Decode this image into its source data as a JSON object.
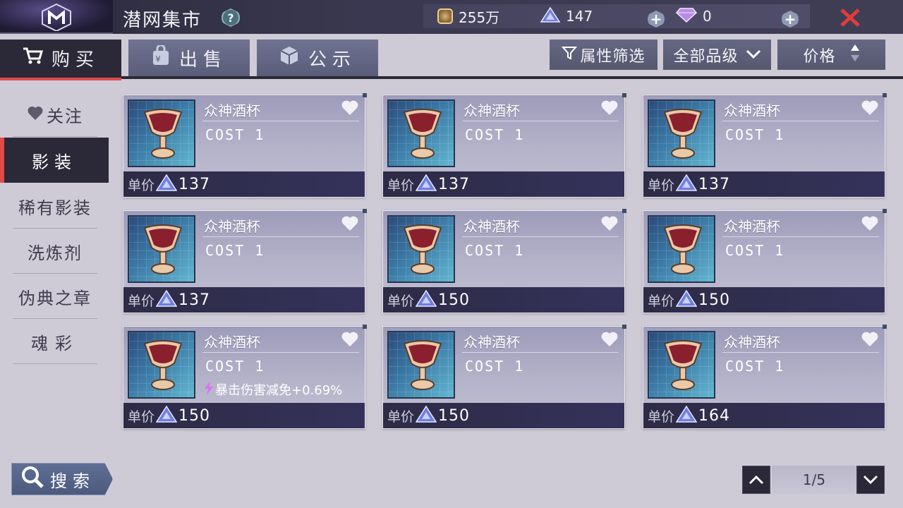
{
  "header": {
    "title": "潜网集市",
    "help_icon": "help-icon",
    "currencies": [
      {
        "icon": "coin-icon",
        "value": "255万"
      },
      {
        "icon": "crystal-icon",
        "value": "147"
      },
      {
        "icon": "diamond-icon",
        "value": "0"
      }
    ],
    "plus_label": "+"
  },
  "tabs": [
    {
      "label": "购买",
      "icon": "cart-icon",
      "active": true
    },
    {
      "label": "出售",
      "icon": "bag-icon",
      "active": false
    },
    {
      "label": "公示",
      "icon": "cube-icon",
      "active": false
    }
  ],
  "filters": {
    "attribute_filter": "属性筛选",
    "grade_select": "全部品级",
    "sort_label": "价格"
  },
  "sidebar": {
    "items": [
      {
        "label": "关注",
        "icon": "heart-icon"
      },
      {
        "label": "影装",
        "active": true
      },
      {
        "label": "稀有影装"
      },
      {
        "label": "洗炼剂"
      },
      {
        "label": "伪典之章"
      },
      {
        "label": "魂彩"
      }
    ]
  },
  "listing": {
    "price_label": "单价",
    "items": [
      {
        "name": "众神酒杯",
        "cost": "COST 1",
        "price": "137",
        "attr": ""
      },
      {
        "name": "众神酒杯",
        "cost": "COST 1",
        "price": "137",
        "attr": ""
      },
      {
        "name": "众神酒杯",
        "cost": "COST 1",
        "price": "137",
        "attr": ""
      },
      {
        "name": "众神酒杯",
        "cost": "COST 1",
        "price": "137",
        "attr": ""
      },
      {
        "name": "众神酒杯",
        "cost": "COST 1",
        "price": "150",
        "attr": ""
      },
      {
        "name": "众神酒杯",
        "cost": "COST 1",
        "price": "150",
        "attr": ""
      },
      {
        "name": "众神酒杯",
        "cost": "COST 1",
        "price": "150",
        "attr": "暴击伤害减免+0.69%"
      },
      {
        "name": "众神酒杯",
        "cost": "COST 1",
        "price": "150",
        "attr": ""
      },
      {
        "name": "众神酒杯",
        "cost": "COST 1",
        "price": "164",
        "attr": ""
      }
    ]
  },
  "search": {
    "label": "搜索"
  },
  "pager": {
    "current": "1/5"
  },
  "colors": {
    "accent_red": "#e24a4a",
    "dark_panel": "#2b2937"
  }
}
